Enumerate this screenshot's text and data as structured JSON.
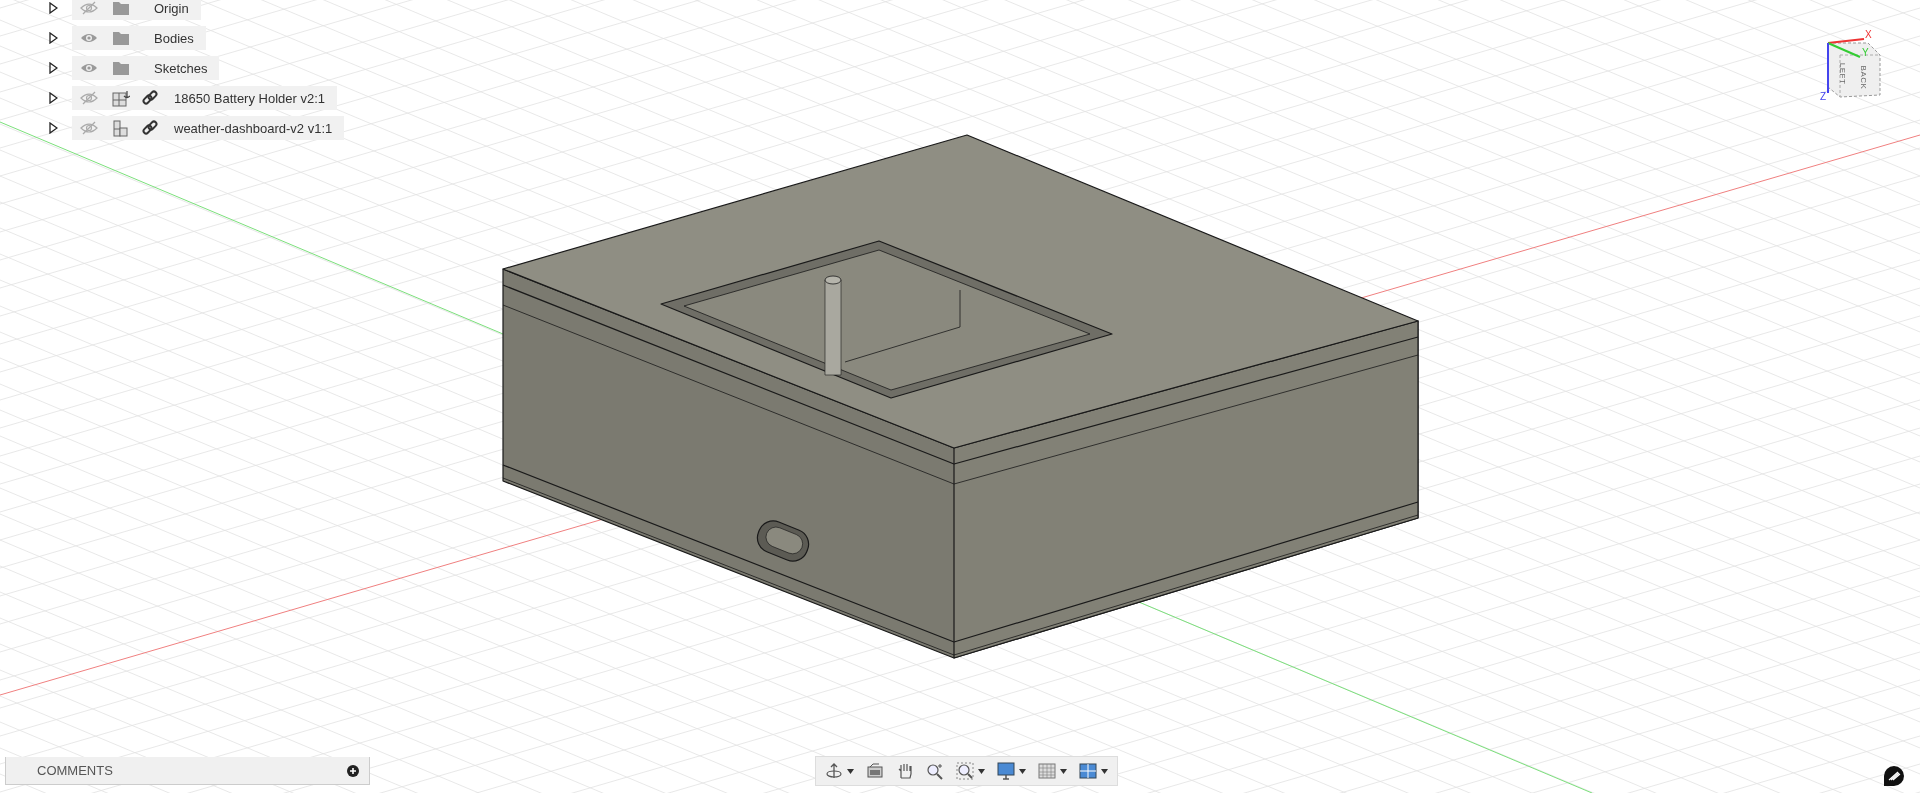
{
  "browser": {
    "items": [
      {
        "name": "Origin",
        "expanded": false,
        "visible": false,
        "kind": "folder",
        "linked": false
      },
      {
        "name": "Bodies",
        "expanded": false,
        "visible": true,
        "kind": "folder",
        "linked": false
      },
      {
        "name": "Sketches",
        "expanded": false,
        "visible": true,
        "kind": "folder",
        "linked": false
      },
      {
        "name": "18650 Battery Holder v2:1",
        "expanded": false,
        "visible": false,
        "kind": "grounded-component",
        "linked": true
      },
      {
        "name": "weather-dashboard-v2 v1:1",
        "expanded": false,
        "visible": false,
        "kind": "component",
        "linked": true
      }
    ]
  },
  "viewcube": {
    "faces": [
      "LEFT",
      "BACK"
    ],
    "axes": [
      "X",
      "Y",
      "Z"
    ]
  },
  "comments": {
    "label": "COMMENTS"
  },
  "navbar": {
    "tools": [
      {
        "kind": "orbit",
        "dropdown": true
      },
      {
        "kind": "look-at",
        "dropdown": false
      },
      {
        "kind": "pan",
        "dropdown": false
      },
      {
        "kind": "zoom",
        "dropdown": false
      },
      {
        "kind": "fit",
        "dropdown": true
      },
      {
        "kind": "display",
        "dropdown": true
      },
      {
        "kind": "grid",
        "dropdown": true
      },
      {
        "kind": "viewports",
        "dropdown": true
      }
    ]
  }
}
